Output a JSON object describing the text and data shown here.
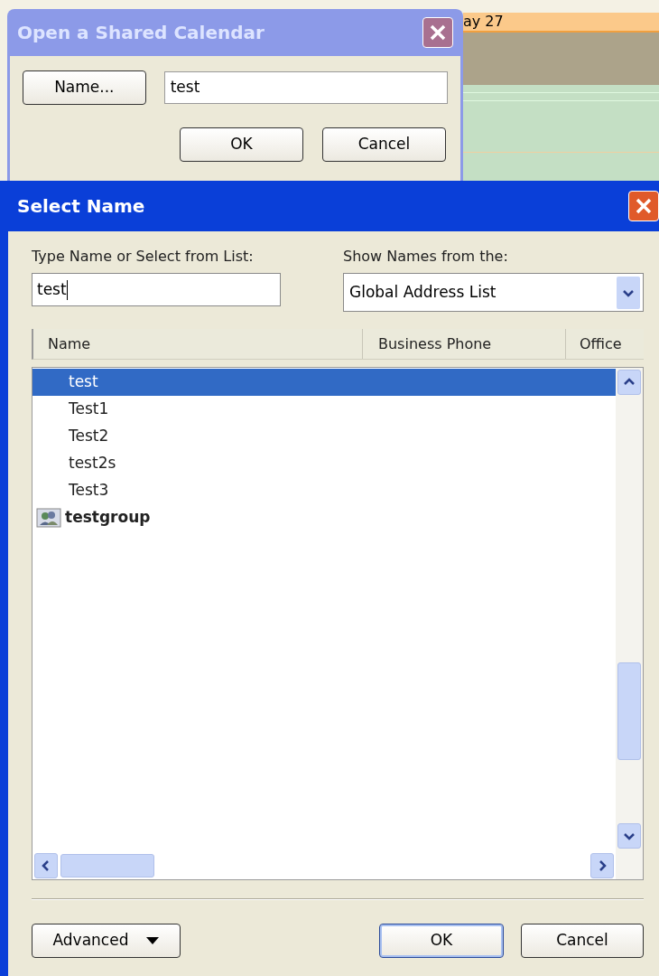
{
  "calendar": {
    "day_header": "ay 27"
  },
  "shared_dialog": {
    "title": "Open a Shared Calendar",
    "name_button": "Name...",
    "name_value": "test",
    "buttons": [
      "OK",
      "Cancel"
    ]
  },
  "select_dialog": {
    "title": "Select Name",
    "type_label": "Type Name or Select from List:",
    "type_value": "test",
    "source_label": "Show Names from the:",
    "source_value": "Global Address List",
    "columns": [
      "Name",
      "Business Phone",
      "Office"
    ],
    "rows": [
      {
        "name": "test",
        "kind": "person",
        "selected": true
      },
      {
        "name": "Test1",
        "kind": "person",
        "selected": false
      },
      {
        "name": "Test2",
        "kind": "person",
        "selected": false
      },
      {
        "name": "test2s",
        "kind": "person",
        "selected": false
      },
      {
        "name": "Test3",
        "kind": "person",
        "selected": false
      },
      {
        "name": "testgroup",
        "kind": "group",
        "selected": false
      }
    ],
    "advanced_button": "Advanced",
    "buttons": [
      "OK",
      "Cancel"
    ]
  }
}
